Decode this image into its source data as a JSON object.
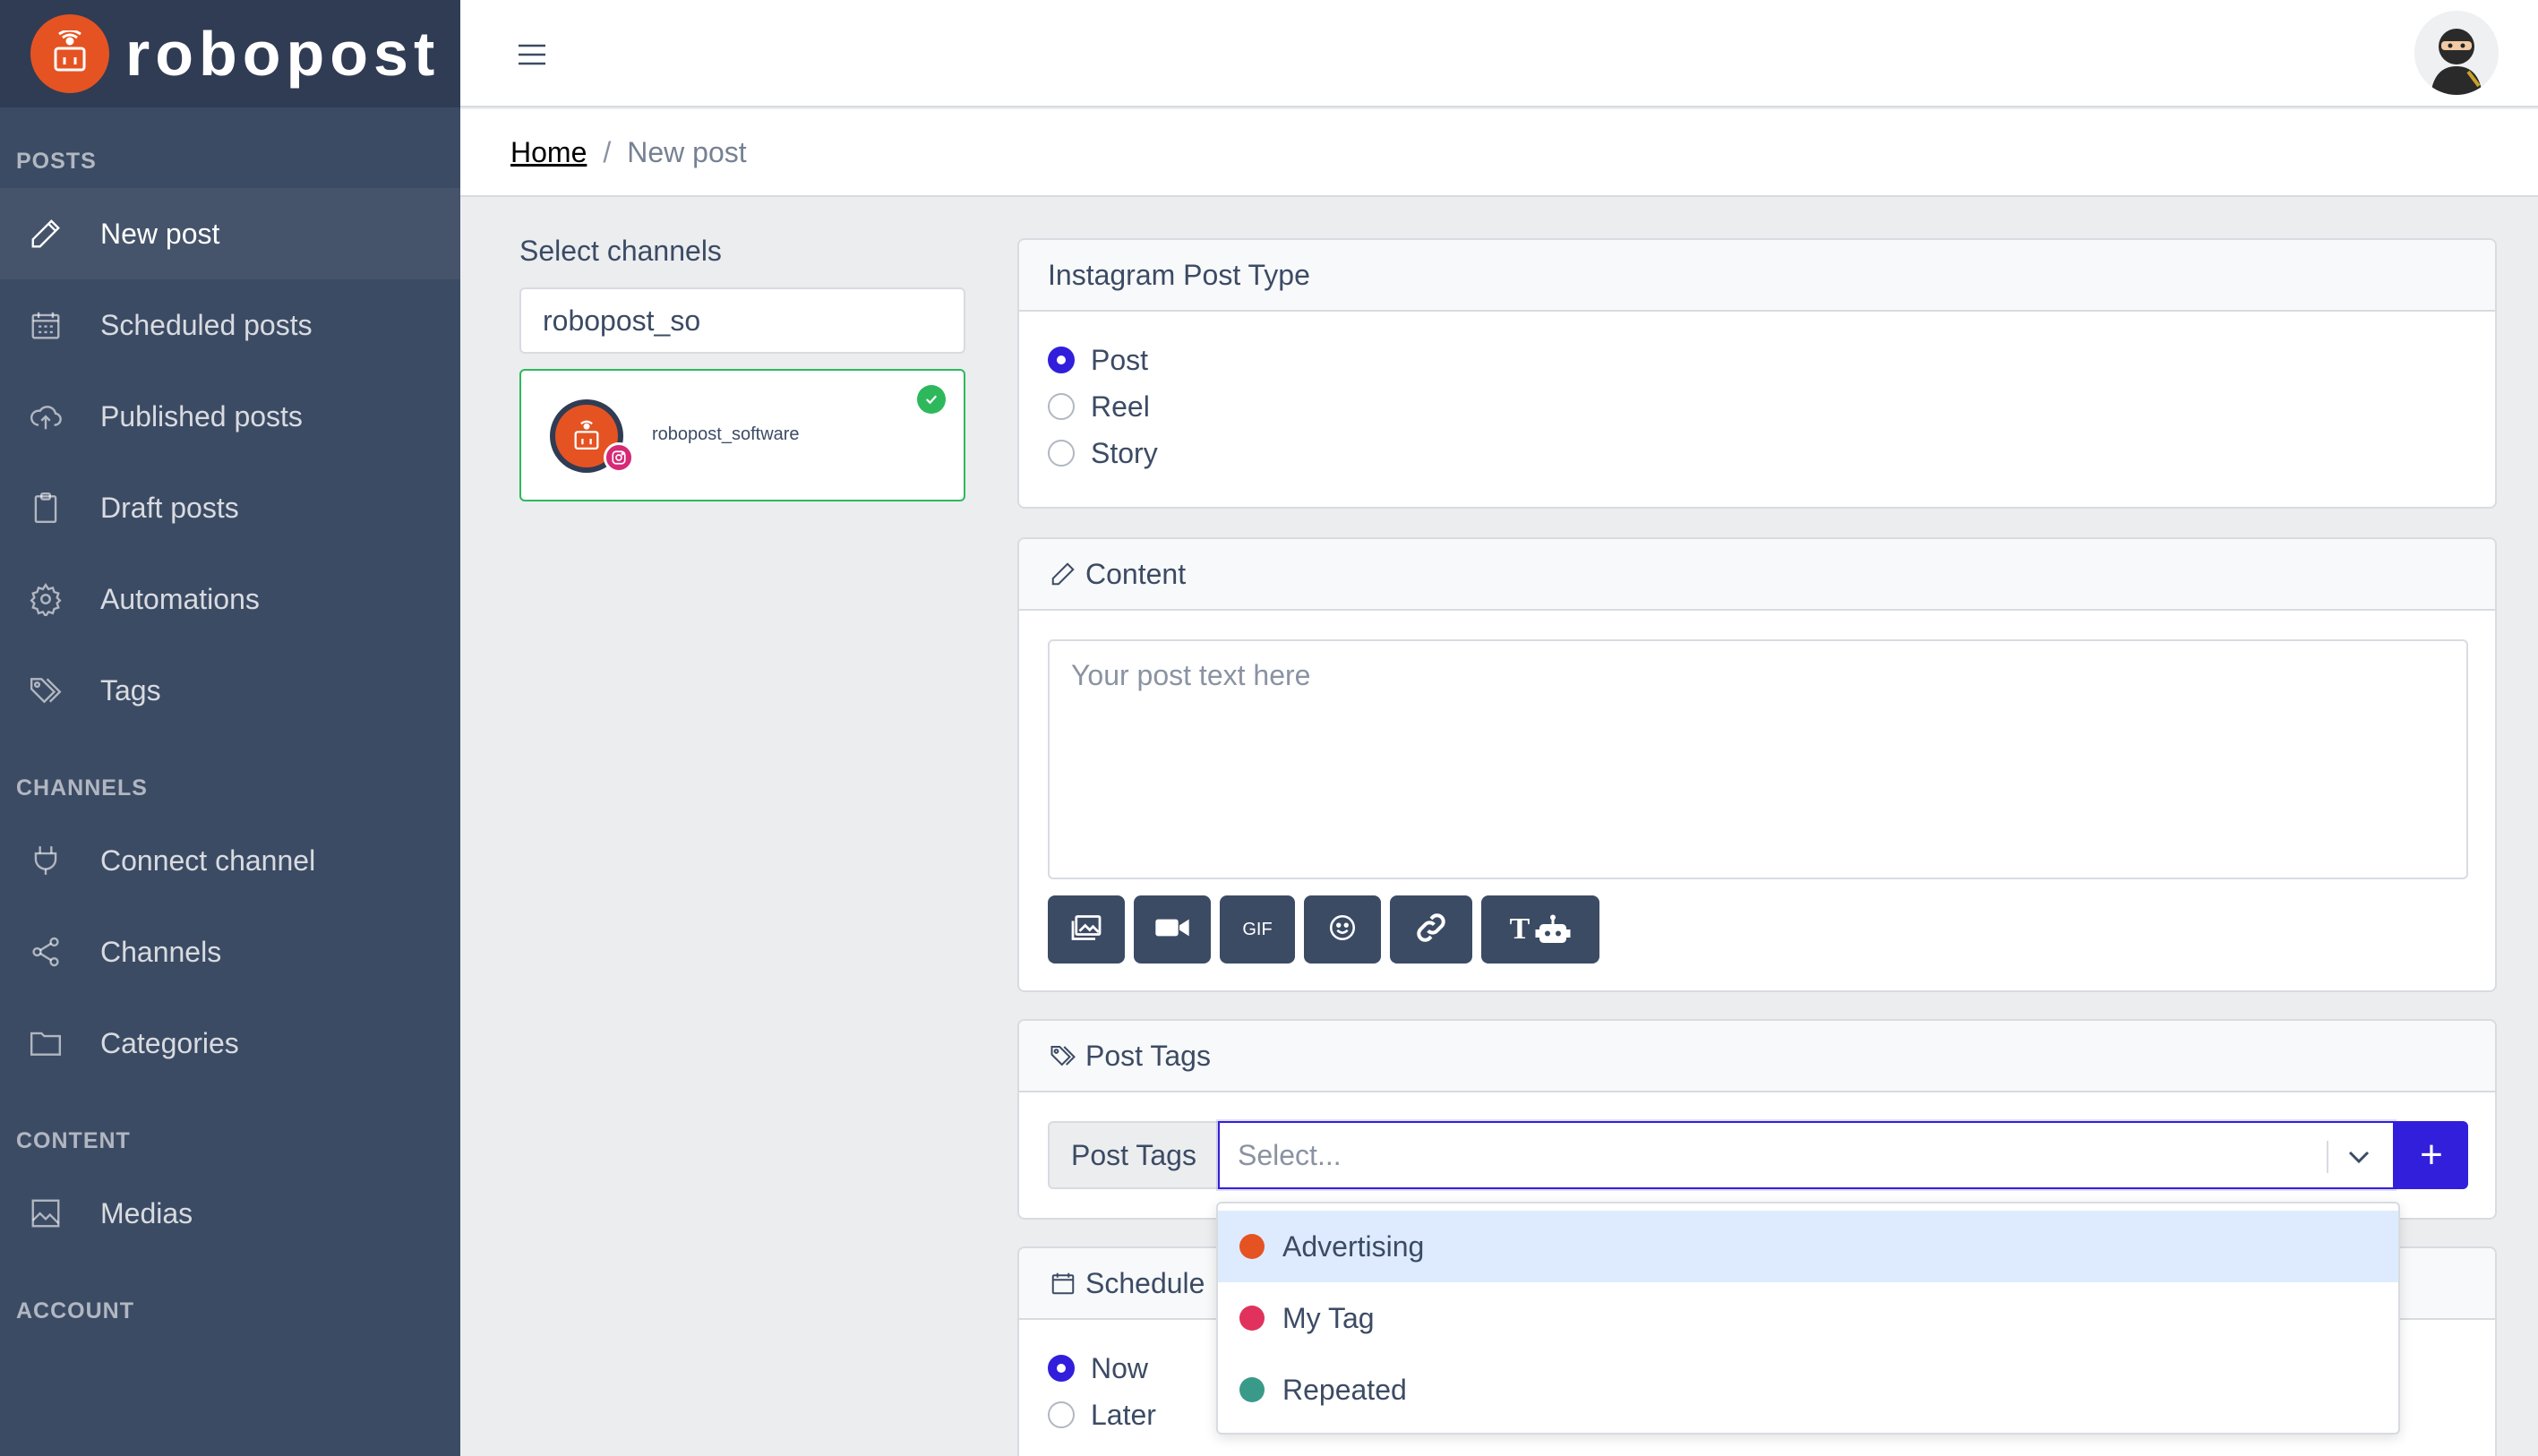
{
  "brand": {
    "name": "robopost"
  },
  "sidebar": {
    "sections": [
      {
        "title": "POSTS",
        "items": [
          {
            "label": "New post",
            "icon": "pencil-icon",
            "active": true
          },
          {
            "label": "Scheduled posts",
            "icon": "calendar-icon"
          },
          {
            "label": "Published posts",
            "icon": "cloud-upload-icon"
          },
          {
            "label": "Draft posts",
            "icon": "clipboard-icon"
          },
          {
            "label": "Automations",
            "icon": "gear-icon"
          },
          {
            "label": "Tags",
            "icon": "tags-icon"
          }
        ]
      },
      {
        "title": "CHANNELS",
        "items": [
          {
            "label": "Connect channel",
            "icon": "plug-icon"
          },
          {
            "label": "Channels",
            "icon": "share-icon"
          },
          {
            "label": "Categories",
            "icon": "folder-icon"
          }
        ]
      },
      {
        "title": "CONTENT",
        "items": [
          {
            "label": "Medias",
            "icon": "image-icon"
          }
        ]
      },
      {
        "title": "ACCOUNT",
        "items": []
      }
    ]
  },
  "breadcrumb": {
    "home": "Home",
    "separator": "/",
    "current": "New post"
  },
  "channels": {
    "title": "Select channels",
    "search_value": "robopost_so",
    "card": {
      "name": "robopost_software",
      "network": "instagram",
      "selected": true
    }
  },
  "post_type": {
    "title": "Instagram Post Type",
    "options": [
      "Post",
      "Reel",
      "Story"
    ],
    "selected": "Post"
  },
  "content": {
    "title": "Content",
    "placeholder": "Your post text here",
    "toolbar": [
      "image-upload-icon",
      "video-icon",
      "gif-icon",
      "emoji-icon",
      "link-icon",
      "ai-text-icon"
    ],
    "gif_label": "GIF",
    "ai_label": "T"
  },
  "tags": {
    "title": "Post Tags",
    "label": "Post Tags",
    "placeholder": "Select...",
    "add_label": "+",
    "options": [
      {
        "label": "Advertising",
        "color": "#e55323"
      },
      {
        "label": "My Tag",
        "color": "#e0325c"
      },
      {
        "label": "Repeated",
        "color": "#3a9a8a"
      }
    ]
  },
  "schedule": {
    "title": "Schedule",
    "options": [
      "Now",
      "Later"
    ],
    "selected": "Now"
  },
  "colors": {
    "sidebar": "#3c4b64",
    "primary": "#321fdb",
    "success": "#2eb85c",
    "brand": "#e55323"
  }
}
